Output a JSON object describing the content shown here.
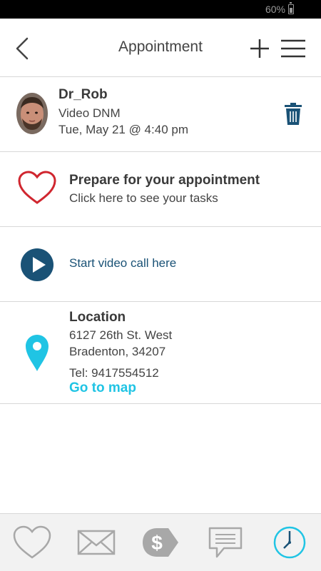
{
  "status_bar": {
    "battery": "60%"
  },
  "header": {
    "title": "Appointment",
    "icons": {
      "back": "back-chevron-icon",
      "add": "plus-icon",
      "menu": "hamburger-menu-icon"
    }
  },
  "appointment": {
    "doctor_name": "Dr_Rob",
    "visit_type": "Video DNM",
    "datetime": "Tue, May 21 @ 4:40 pm",
    "delete_icon": "trash-icon"
  },
  "prepare": {
    "title": "Prepare for your appointment",
    "subtitle": "Click here to see your tasks",
    "icon": "heart-icon"
  },
  "video": {
    "label": "Start video call here",
    "icon": "play-icon"
  },
  "location": {
    "title": "Location",
    "address_line1": "6127 26th St. West",
    "address_line2": "Bradenton, 34207",
    "tel": "Tel: 9417554512",
    "map_link": "Go to map",
    "icon": "map-pin-icon"
  },
  "tabbar": {
    "tabs": [
      {
        "icon": "heart-icon",
        "active": false
      },
      {
        "icon": "mail-icon",
        "active": false
      },
      {
        "icon": "dollar-tag-icon",
        "active": false
      },
      {
        "icon": "chat-icon",
        "active": false
      },
      {
        "icon": "clock-icon",
        "active": true
      }
    ]
  },
  "colors": {
    "heart_red": "#d0262f",
    "navy": "#1a5276",
    "cyan": "#20c4e4",
    "tab_gray": "#a8a8a8"
  }
}
